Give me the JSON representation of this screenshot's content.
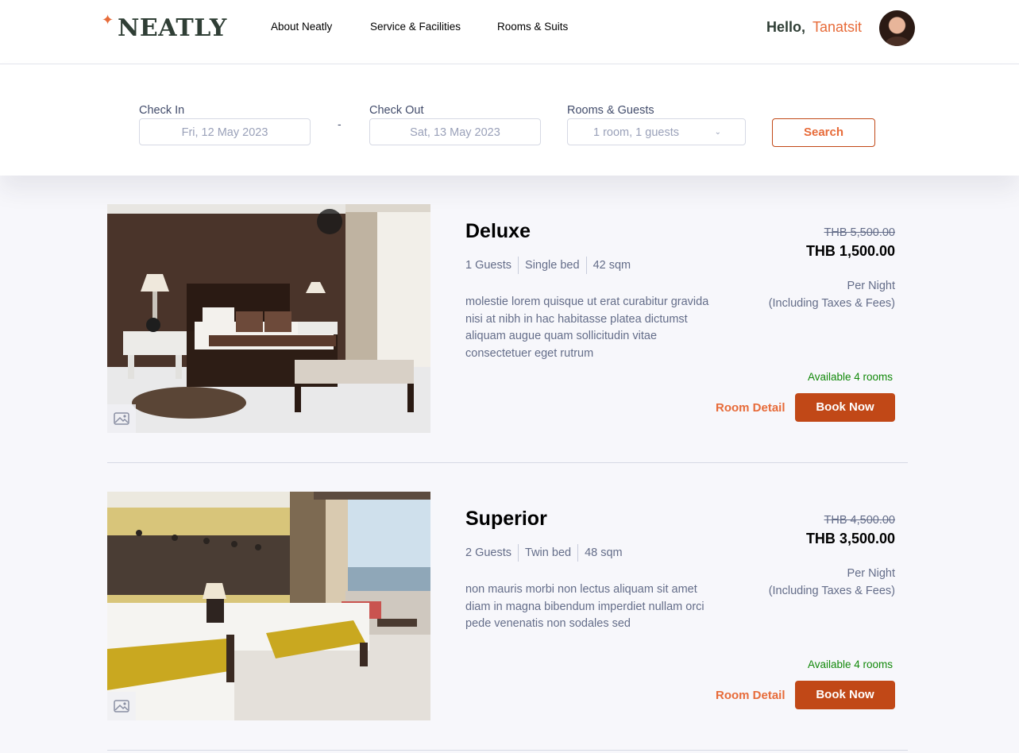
{
  "header": {
    "logo": "NEATLY",
    "nav": [
      "About Neatly",
      "Service & Facilities",
      "Rooms & Suits"
    ],
    "greeting": "Hello,",
    "user_name": "Tanatsit"
  },
  "search": {
    "check_in_label": "Check In",
    "check_in_value": "Fri, 12 May 2023",
    "separator": "-",
    "check_out_label": "Check Out",
    "check_out_value": "Sat, 13 May 2023",
    "rooms_label": "Rooms & Guests",
    "rooms_value": "1 room, 1 guests",
    "search_label": "Search"
  },
  "rooms": [
    {
      "name": "Deluxe",
      "guests": "1 Guests",
      "bed": "Single bed",
      "size": "42 sqm",
      "description": "molestie lorem quisque ut erat curabitur gravida nisi at nibh in hac habitasse platea dictumst aliquam augue quam sollicitudin vitae consectetuer eget rutrum",
      "old_price": "THB 5,500.00",
      "price": "THB 1,500.00",
      "per_night": "Per Night",
      "taxes": "(Including Taxes & Fees)",
      "availability": "Available 4 rooms",
      "detail_label": "Room Detail",
      "book_label": "Book Now"
    },
    {
      "name": "Superior",
      "guests": "2 Guests",
      "bed": "Twin bed",
      "size": "48 sqm",
      "description": "non mauris morbi non lectus aliquam sit amet diam in magna bibendum imperdiet nullam orci pede venenatis non sodales sed",
      "old_price": "THB 4,500.00",
      "price": "THB 3,500.00",
      "per_night": "Per Night",
      "taxes": "(Including Taxes & Fees)",
      "availability": "Available 4 rooms",
      "detail_label": "Room Detail",
      "book_label": "Book Now"
    }
  ],
  "colors": {
    "brand_orange": "#e76b39",
    "button_orange": "#c14817",
    "logo_green": "#2f3e35",
    "available_green": "#12890a"
  },
  "icons": [
    "sparkle-icon",
    "chevron-down-icon",
    "image-icon"
  ]
}
